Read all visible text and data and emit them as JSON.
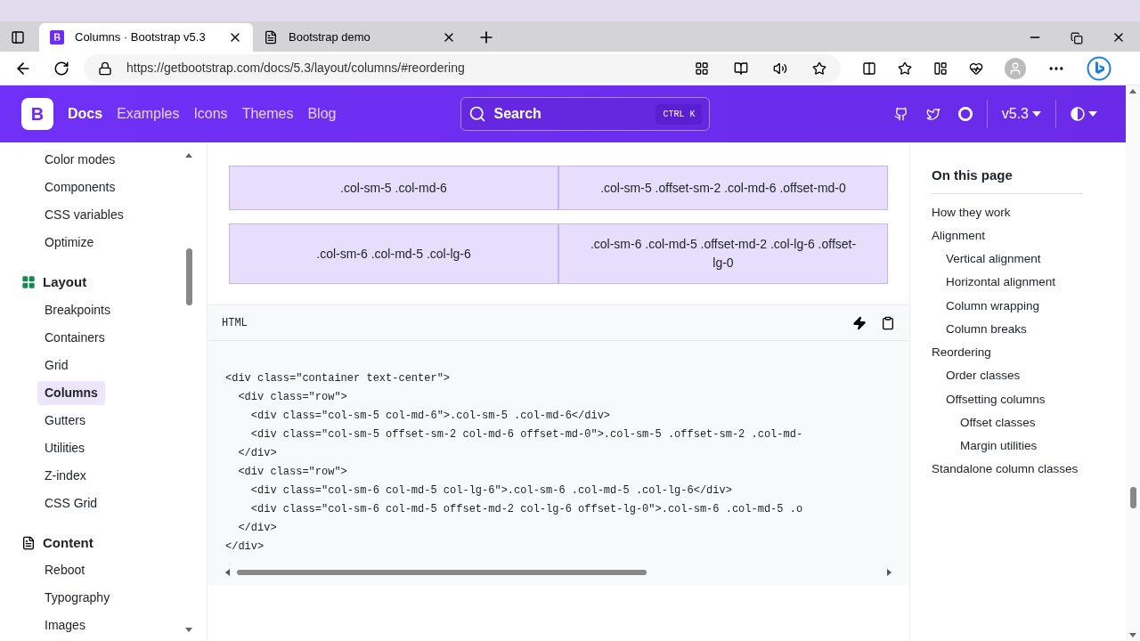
{
  "browser": {
    "tabs": [
      {
        "title": "Columns · Bootstrap v5.3",
        "selected": true,
        "kind": "bootstrap"
      },
      {
        "title": "Bootstrap demo",
        "selected": false,
        "kind": "page"
      }
    ],
    "url": "https://getbootstrap.com/docs/5.3/layout/columns/#reordering"
  },
  "navbar": {
    "logo": "B",
    "links": [
      {
        "label": "Docs",
        "selected": true
      },
      {
        "label": "Examples",
        "selected": false
      },
      {
        "label": "Icons",
        "selected": false
      },
      {
        "label": "Themes",
        "selected": false
      },
      {
        "label": "Blog",
        "selected": false
      }
    ],
    "search": {
      "placeholder": "Search",
      "shortcut_modifier": "CTRL",
      "shortcut_key": "K"
    },
    "version": "v5.3"
  },
  "sidebar": {
    "groups": [
      {
        "items": [
          {
            "label": "Color modes",
            "selected": false
          },
          {
            "label": "Components",
            "selected": false
          },
          {
            "label": "CSS variables",
            "selected": false
          },
          {
            "label": "Optimize",
            "selected": false
          }
        ]
      },
      {
        "title": "Layout",
        "kind": "grid",
        "items": [
          {
            "label": "Breakpoints",
            "selected": false
          },
          {
            "label": "Containers",
            "selected": false
          },
          {
            "label": "Grid",
            "selected": false
          },
          {
            "label": "Columns",
            "selected": true
          },
          {
            "label": "Gutters",
            "selected": false
          },
          {
            "label": "Utilities",
            "selected": false
          },
          {
            "label": "Z-index",
            "selected": false
          },
          {
            "label": "CSS Grid",
            "selected": false
          }
        ]
      },
      {
        "title": "Content",
        "kind": "document",
        "items": [
          {
            "label": "Reboot",
            "selected": false
          },
          {
            "label": "Typography",
            "selected": false
          },
          {
            "label": "Images",
            "selected": false
          }
        ]
      }
    ]
  },
  "example": {
    "rows": [
      [
        ".col-sm-5 .col-md-6",
        ".col-sm-5 .offset-sm-2 .col-md-6 .offset-md-0"
      ],
      [
        ".col-sm-6 .col-md-5 .col-lg-6",
        ".col-sm-6 .col-md-5 .offset-md-2 .col-lg-6 .offset-lg-0"
      ]
    ],
    "code_language": "HTML",
    "code_lines": [
      "<div class=\"container text-center\">",
      "  <div class=\"row\">",
      "    <div class=\"col-sm-5 col-md-6\">.col-sm-5 .col-md-6</div>",
      "    <div class=\"col-sm-5 offset-sm-2 col-md-6 offset-md-0\">.col-sm-5 .offset-sm-2 .col-md-",
      "  </div>",
      "  <div class=\"row\">",
      "    <div class=\"col-sm-6 col-md-5 col-lg-6\">.col-sm-6 .col-md-5 .col-lg-6</div>",
      "    <div class=\"col-sm-6 col-md-5 offset-md-2 col-lg-6 offset-lg-0\">.col-sm-6 .col-md-5 .o",
      "  </div>",
      "</div>"
    ]
  },
  "toc": {
    "title": "On this page",
    "items": [
      {
        "label": "How they work"
      },
      {
        "label": "Alignment",
        "children": [
          {
            "label": "Vertical alignment"
          },
          {
            "label": "Horizontal alignment"
          },
          {
            "label": "Column wrapping"
          },
          {
            "label": "Column breaks"
          }
        ]
      },
      {
        "label": "Reordering",
        "children": [
          {
            "label": "Order classes"
          },
          {
            "label": "Offsetting columns",
            "children": [
              {
                "label": "Offset classes"
              },
              {
                "label": "Margin utilities"
              }
            ]
          }
        ]
      },
      {
        "label": "Standalone column classes"
      }
    ]
  }
}
